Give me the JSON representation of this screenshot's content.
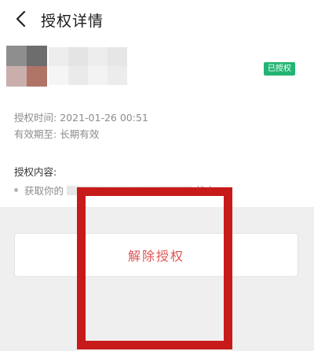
{
  "header": {
    "back_icon": "chevron-left-icon",
    "title": "授权详情"
  },
  "app": {
    "status_badge": "已授权",
    "badge_color": "#22b573"
  },
  "meta": {
    "auth_time_label": "授权时间:",
    "auth_time_value": "2021-01-26 00:51",
    "valid_label": "有效期至:",
    "valid_value": "长期有效"
  },
  "scope": {
    "label": "授权内容:",
    "item_prefix": "获取你的",
    "item_suffix": "状态"
  },
  "actions": {
    "revoke_label": "解除授权",
    "revoke_color": "#e05252"
  },
  "highlight": {
    "color": "#c71a1a"
  }
}
